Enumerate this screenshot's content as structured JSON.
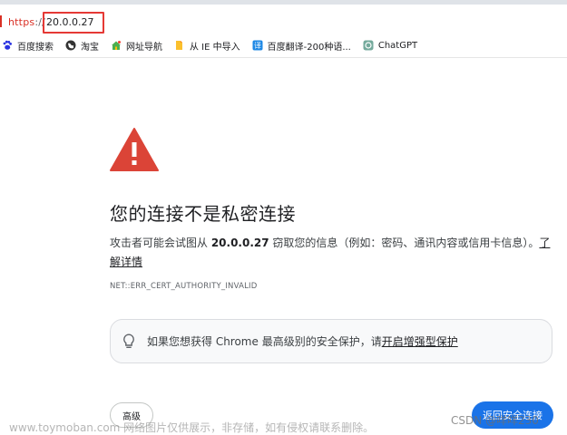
{
  "address_bar": {
    "scheme": "https",
    "slashes": "://",
    "host": "20.0.0.27"
  },
  "bookmarks": [
    {
      "label": "百度搜索",
      "icon": "paw-icon"
    },
    {
      "label": "淘宝",
      "icon": "globe-icon"
    },
    {
      "label": "网址导航",
      "icon": "house-icon"
    },
    {
      "label": "从 IE 中导入",
      "icon": "folder-icon"
    },
    {
      "label": "百度翻译-200种语...",
      "icon": "translate-icon"
    },
    {
      "label": "ChatGPT",
      "icon": "chatgpt-icon"
    }
  ],
  "main": {
    "title": "您的连接不是私密连接",
    "desc_prefix": "攻击者可能会试图从 ",
    "desc_ip": "20.0.0.27",
    "desc_suffix": " 窃取您的信息（例如：密码、通讯内容或信用卡信息）。",
    "learn_more": "了解详情",
    "error_code": "NET::ERR_CERT_AUTHORITY_INVALID",
    "enhanced_prefix": "如果您想获得 Chrome 最高级别的安全保护，请",
    "enhanced_link": "开启增强型保护",
    "advanced_button": "高级",
    "back_button": "返回安全连接"
  },
  "watermarks": {
    "left": "www.toymoban.com 网络图片仅供展示，非存储，如有侵权请联系删除。",
    "right": "CSDN @咩咩230"
  },
  "colors": {
    "danger": "#d93025",
    "warning_triangle": "#db4437",
    "primary_button": "#1a73e8"
  }
}
